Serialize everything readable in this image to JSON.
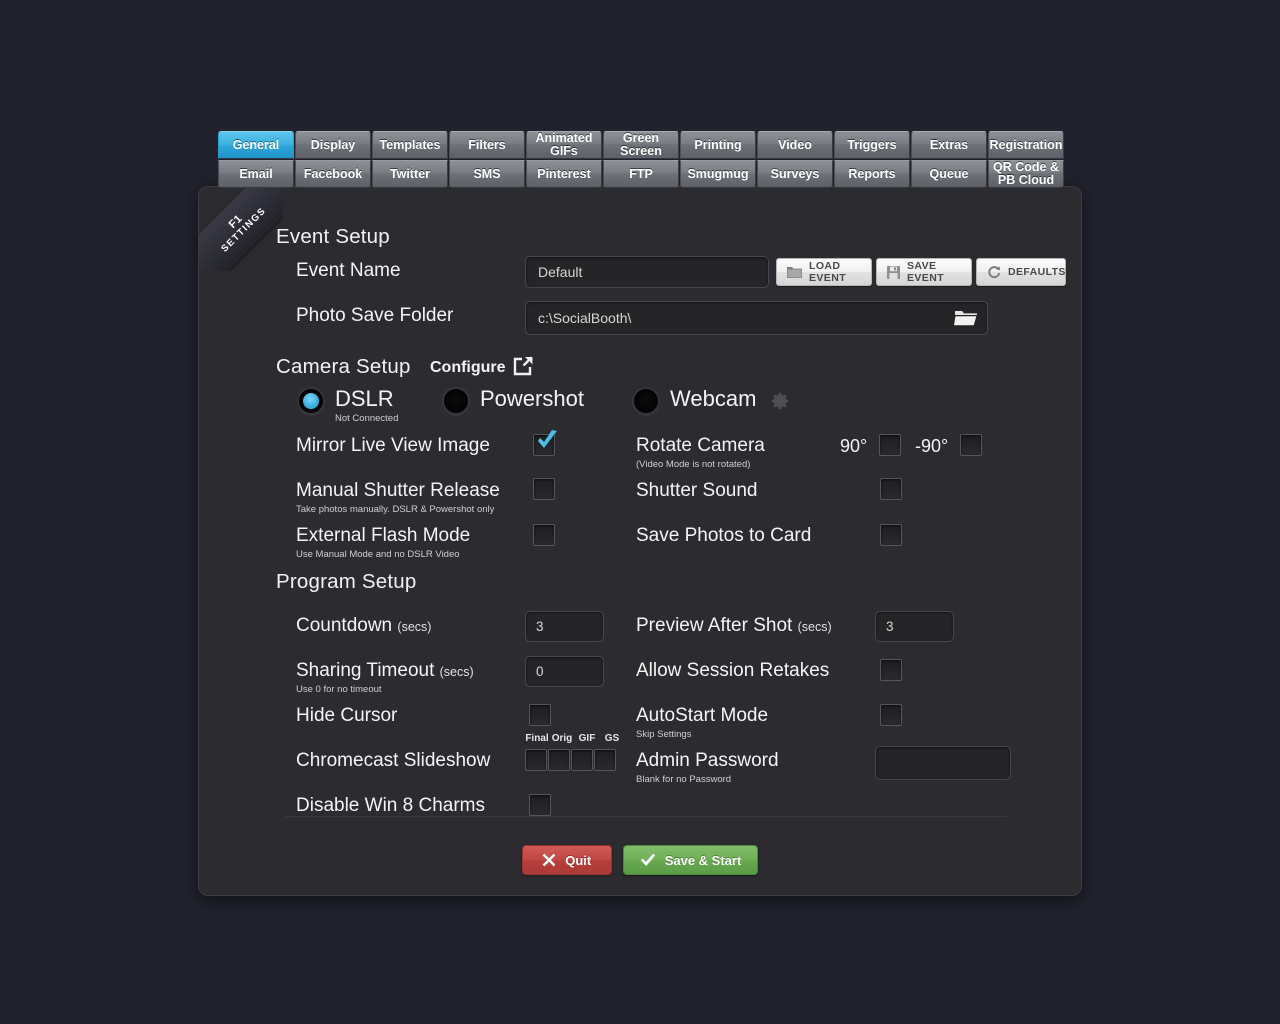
{
  "app": {
    "ribbon_line1": "F1",
    "ribbon_line2": "SETTINGS",
    "background_color": "#22222e",
    "panel_color": "#2c2c30",
    "accent_color": "#3eb2e2"
  },
  "tabs": {
    "row1": [
      {
        "label": "General",
        "active": true
      },
      {
        "label": "Display",
        "active": false
      },
      {
        "label": "Templates",
        "active": false
      },
      {
        "label": "Filters",
        "active": false
      },
      {
        "label": "Animated GIFs",
        "active": false
      },
      {
        "label": "Green Screen",
        "active": false
      },
      {
        "label": "Printing",
        "active": false
      },
      {
        "label": "Video",
        "active": false
      },
      {
        "label": "Triggers",
        "active": false
      },
      {
        "label": "Extras",
        "active": false
      },
      {
        "label": "Registration",
        "active": false
      }
    ],
    "row2": [
      {
        "label": "Email",
        "active": false
      },
      {
        "label": "Facebook",
        "active": false
      },
      {
        "label": "Twitter",
        "active": false
      },
      {
        "label": "SMS",
        "active": false
      },
      {
        "label": "Pinterest",
        "active": false
      },
      {
        "label": "FTP",
        "active": false
      },
      {
        "label": "Smugmug",
        "active": false
      },
      {
        "label": "Surveys",
        "active": false
      },
      {
        "label": "Reports",
        "active": false
      },
      {
        "label": "Queue",
        "active": false
      },
      {
        "label": "QR Code & PB Cloud",
        "active": false
      }
    ]
  },
  "event_setup": {
    "title": "Event Setup",
    "event_name_label": "Event Name",
    "event_name_value": "Default",
    "load_event_button": "LOAD EVENT",
    "save_event_button": "SAVE EVENT",
    "defaults_button": "DEFAULTS",
    "photo_folder_label": "Photo Save Folder",
    "photo_folder_value": "c:\\SocialBooth\\"
  },
  "camera_setup": {
    "title": "Camera Setup",
    "configure_label": "Configure",
    "dslr_label": "DSLR",
    "dslr_status": "Not Connected",
    "dslr_selected": true,
    "powershot_label": "Powershot",
    "powershot_selected": false,
    "webcam_label": "Webcam",
    "webcam_selected": false,
    "mirror_label": "Mirror Live View Image",
    "mirror_checked": true,
    "rotate_label": "Rotate Camera",
    "rotate_sub": "(Video Mode is not rotated)",
    "rotate_90_label": "90°",
    "rotate_90_checked": false,
    "rotate_neg90_label": "-90°",
    "rotate_neg90_checked": false,
    "manual_shutter_label": "Manual Shutter Release",
    "manual_shutter_sub": "Take photos manually.  DSLR & Powershot only",
    "manual_shutter_checked": false,
    "shutter_sound_label": "Shutter Sound",
    "shutter_sound_checked": false,
    "external_flash_label": "External Flash Mode",
    "external_flash_sub": "Use Manual Mode and no DSLR Video",
    "external_flash_checked": false,
    "save_to_card_label": "Save Photos to Card",
    "save_to_card_checked": false
  },
  "program_setup": {
    "title": "Program Setup",
    "countdown_label": "Countdown",
    "countdown_unit": "(secs)",
    "countdown_value": "3",
    "preview_label": "Preview After Shot",
    "preview_unit": "(secs)",
    "preview_value": "3",
    "sharing_timeout_label": "Sharing Timeout",
    "sharing_timeout_unit": "(secs)",
    "sharing_timeout_sub": "Use 0 for no timeout",
    "sharing_timeout_value": "0",
    "retakes_label": "Allow Session Retakes",
    "retakes_checked": false,
    "hide_cursor_label": "Hide Cursor",
    "hide_cursor_checked": false,
    "autostart_label": "AutoStart Mode",
    "autostart_sub": "Skip Settings",
    "autostart_checked": false,
    "chromecast_label": "Chromecast Slideshow",
    "chromecast_options": [
      {
        "label": "Final",
        "checked": false
      },
      {
        "label": "Orig",
        "checked": false
      },
      {
        "label": "GIF",
        "checked": false
      },
      {
        "label": "GS",
        "checked": false
      }
    ],
    "admin_password_label": "Admin Password",
    "admin_password_sub": "Blank for no Password",
    "admin_password_value": "",
    "disable_charms_label": "Disable Win 8 Charms",
    "disable_charms_checked": false
  },
  "footer": {
    "quit_label": "Quit",
    "save_start_label": "Save & Start"
  }
}
